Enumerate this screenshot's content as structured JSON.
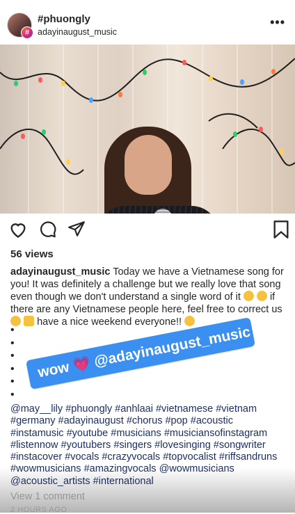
{
  "header": {
    "username": "#phuongly",
    "subtitle": "adayinaugust_music",
    "more_label": "•••"
  },
  "post": {
    "views": "56 views",
    "author": "adayinaugust_music",
    "caption_part1": "Today we have a Vietnamese song for you! It was definitely a challenge but we really love that song even though we don't understand a single word of it",
    "caption_part2": "if there are any Vietnamese people here, feel free to correct us",
    "caption_part3": "have a nice weekend everyone!!",
    "bullets": [
      "•",
      "•",
      "•",
      "•",
      "•",
      "•"
    ],
    "hashtags": "@may__lily #phuongly #anhlaai #vietnamese #vietnam #germany #adayinaugust #chorus #pop #acoustic #instamusic #youtube #musicians #musiciansofinstagram #listennow #youtubers #singers #lovesinging #songwriter #instacover #vocals #crazyvocals #topvocalist #riffsandruns #wowmusicians #amazingvocals @wowmusicians @acoustic_artists #international",
    "comments": "View 1 comment",
    "date": "2 HOURS AGO"
  },
  "sticker": {
    "word": "wow",
    "heart": "💗",
    "mention": "@adayinaugust_music"
  },
  "icons": [
    "heart-icon",
    "comment-icon",
    "share-icon",
    "bookmark-icon"
  ],
  "colors": {
    "text": "#262626",
    "hashtag": "#1c2f63",
    "sticker_bg": "#3b8ff0",
    "muted": "#b4b4b4"
  }
}
